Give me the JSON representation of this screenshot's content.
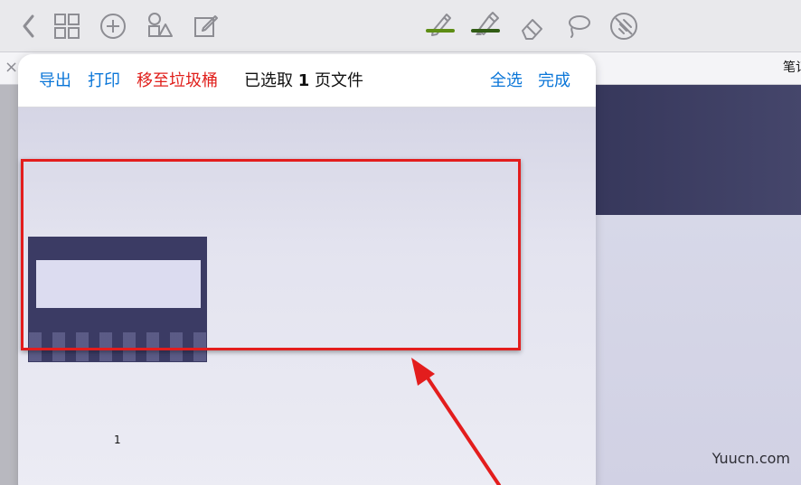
{
  "toolbar": {
    "icons": [
      "back-chevron-icon",
      "grid-view-icon",
      "add-page-icon",
      "shapes-icon",
      "edit-note-icon",
      "pen-icon",
      "highlighter-icon",
      "eraser-icon",
      "lasso-icon",
      "disable-touch-icon"
    ],
    "colors": {
      "pen_underline": "#5d8d14",
      "highlighter_underline": "#315c15"
    }
  },
  "popover": {
    "buttons": {
      "export": "导出",
      "print": "打印",
      "move_to_trash": "移至垃圾桶",
      "select_all": "全选",
      "done": "完成"
    },
    "selection": {
      "prefix": "已选取",
      "count": "1",
      "suffix": "页文件"
    },
    "thumbnail": {
      "page_number": "1"
    }
  },
  "document": {
    "title_visible": "笔记"
  },
  "watermark": "Yuucn.com",
  "colors": {
    "link_blue": "#0a76d8",
    "danger_red": "#e0201c",
    "annotation_red": "#e31d1d",
    "doc_header_dark": "#3e3f63"
  }
}
